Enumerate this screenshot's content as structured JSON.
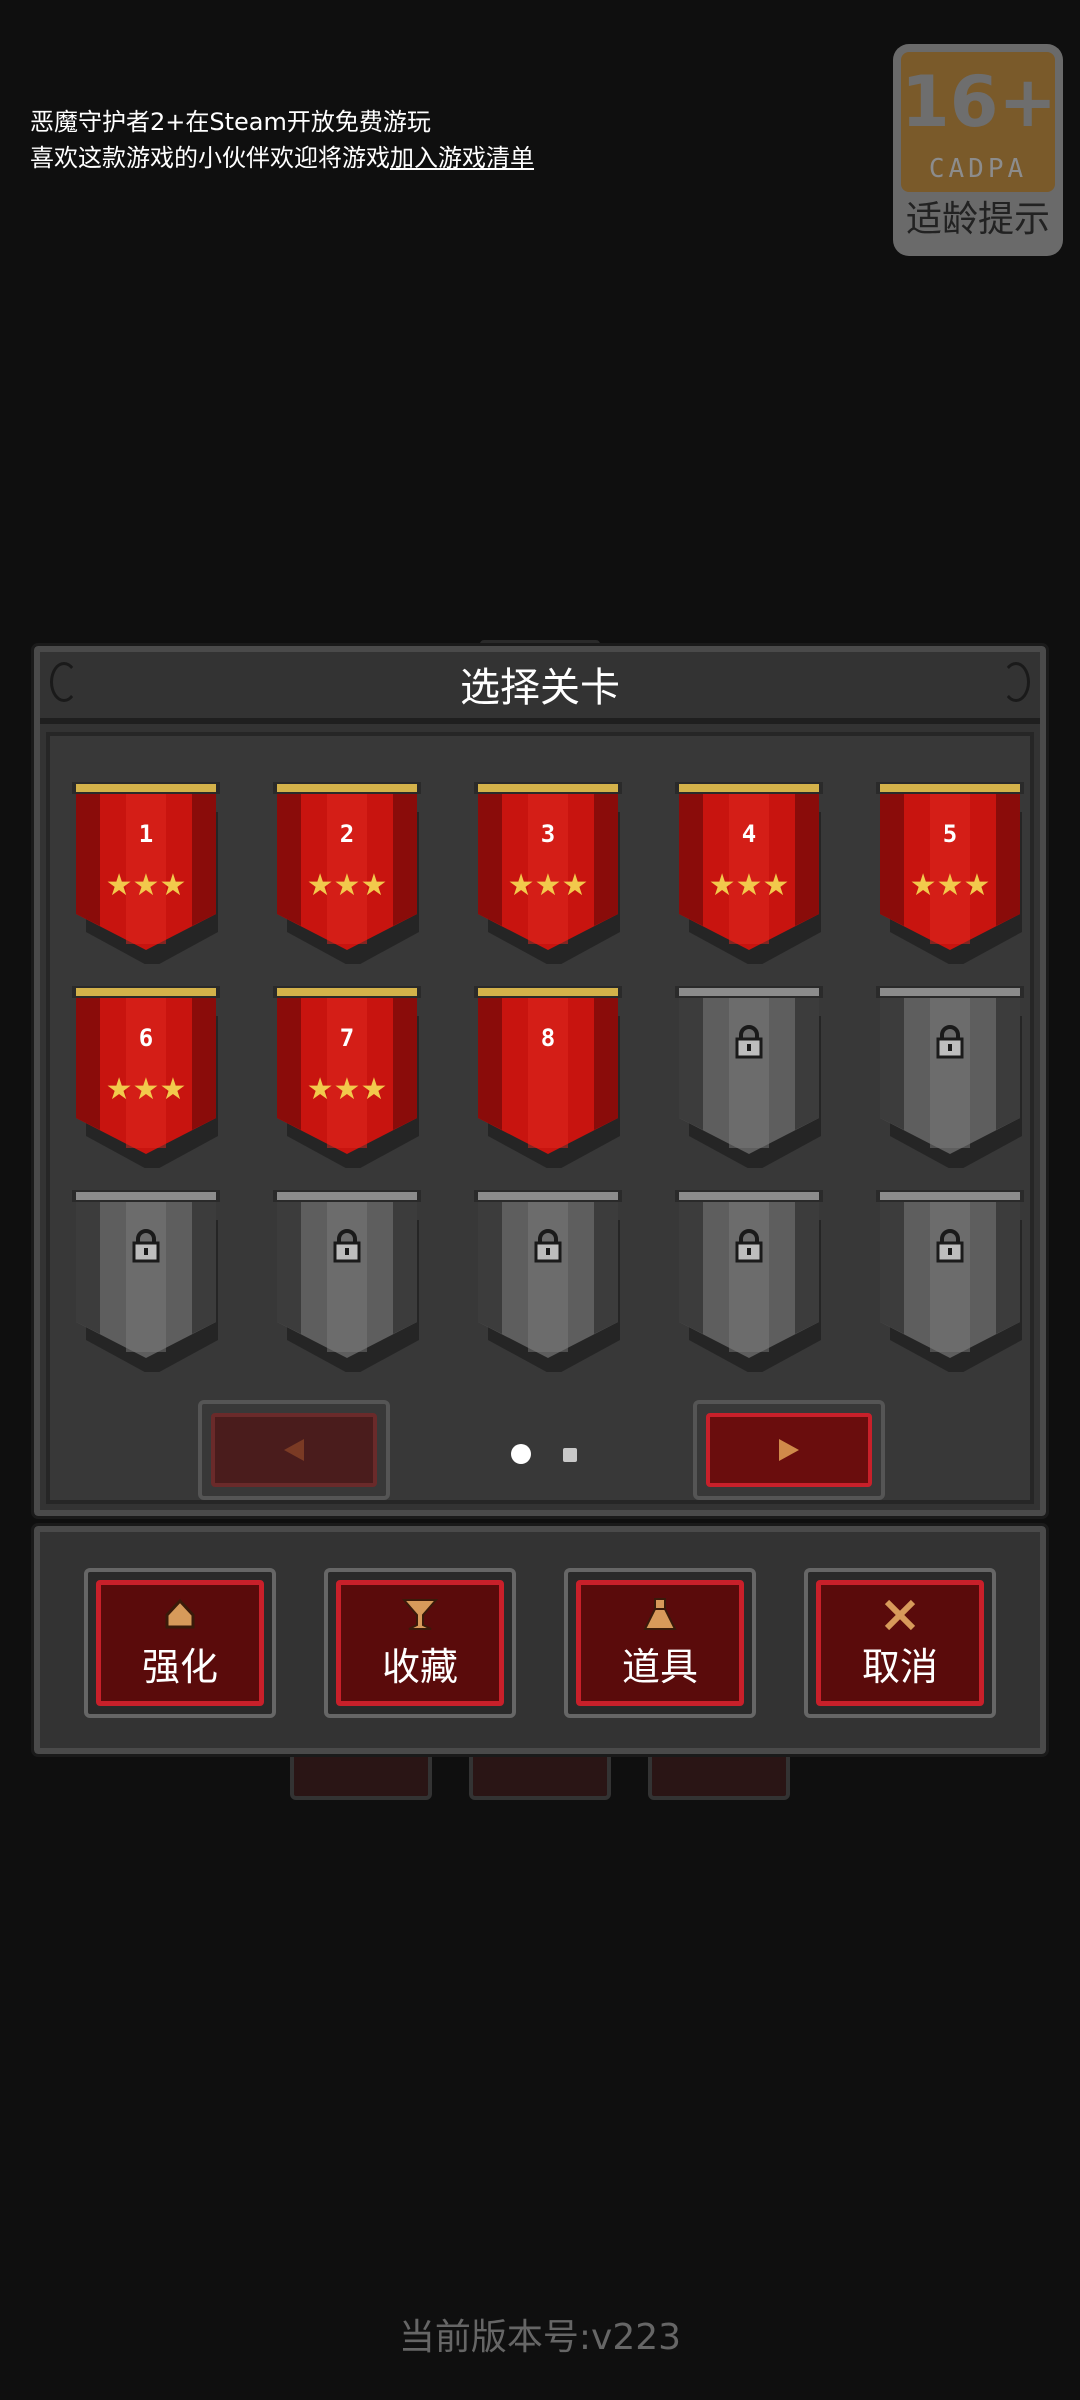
{
  "notice": {
    "line1": "恶魔守护者2+在Steam开放免费游玩",
    "line2_prefix": "喜欢这款游戏的小伙伴欢迎将游戏",
    "line2_link": "加入游戏清单"
  },
  "age_badge": {
    "age": "16+",
    "org": "CADPA",
    "tip": "适龄提示"
  },
  "panel": {
    "title": "选择关卡"
  },
  "levels": [
    {
      "number": "1",
      "stars": 3,
      "locked": false
    },
    {
      "number": "2",
      "stars": 3,
      "locked": false
    },
    {
      "number": "3",
      "stars": 3,
      "locked": false
    },
    {
      "number": "4",
      "stars": 3,
      "locked": false
    },
    {
      "number": "5",
      "stars": 3,
      "locked": false
    },
    {
      "number": "6",
      "stars": 3,
      "locked": false
    },
    {
      "number": "7",
      "stars": 3,
      "locked": false
    },
    {
      "number": "8",
      "stars": 0,
      "locked": false
    },
    {
      "number": "",
      "stars": 0,
      "locked": true
    },
    {
      "number": "",
      "stars": 0,
      "locked": true
    },
    {
      "number": "",
      "stars": 0,
      "locked": true
    },
    {
      "number": "",
      "stars": 0,
      "locked": true
    },
    {
      "number": "",
      "stars": 0,
      "locked": true
    },
    {
      "number": "",
      "stars": 0,
      "locked": true
    },
    {
      "number": "",
      "stars": 0,
      "locked": true
    }
  ],
  "pager": {
    "current_page": 1,
    "total_pages": 2
  },
  "actions": [
    {
      "label": "强化",
      "icon": "upgrade-icon"
    },
    {
      "label": "收藏",
      "icon": "trophy-icon"
    },
    {
      "label": "道具",
      "icon": "potion-icon"
    },
    {
      "label": "取消",
      "icon": "close-icon"
    }
  ],
  "version": "当前版本号:v223",
  "colors": {
    "banner_red": "#c8140f",
    "banner_gray": "#5e5e5e",
    "star": "#f2c94c",
    "button_border": "#c8202a"
  }
}
